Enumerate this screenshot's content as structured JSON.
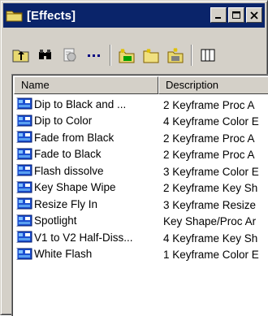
{
  "window": {
    "title": "[Effects]"
  },
  "toolbar": {
    "tools": [
      {
        "icon": "up-folder-icon"
      },
      {
        "icon": "find-icon"
      },
      {
        "icon": "properties-icon"
      },
      {
        "icon": "small-icons-view-icon"
      },
      {
        "icon": "new-folder-icon"
      },
      {
        "icon": "open-folder-icon"
      },
      {
        "icon": "folder-properties-icon"
      },
      {
        "icon": "columns-icon"
      }
    ]
  },
  "list": {
    "columns": [
      "Name",
      "Description"
    ],
    "rows": [
      {
        "name": "Dip to Black and ...",
        "description": "2 Keyframe Proc A"
      },
      {
        "name": "Dip to Color",
        "description": "4 Keyframe Color E"
      },
      {
        "name": "Fade from Black",
        "description": "2 Keyframe Proc A"
      },
      {
        "name": "Fade to Black",
        "description": "2 Keyframe Proc A"
      },
      {
        "name": "Flash dissolve",
        "description": "3 Keyframe Color E"
      },
      {
        "name": "Key Shape Wipe",
        "description": "2 Keyframe Key Sh"
      },
      {
        "name": "Resize Fly In",
        "description": "3 Keyframe Resize"
      },
      {
        "name": "Spotlight",
        "description": "Key Shape/Proc Ar"
      },
      {
        "name": "V1 to V2 Half-Diss...",
        "description": "4 Keyframe Key Sh"
      },
      {
        "name": "White Flash",
        "description": "1 Keyframe Color E"
      }
    ]
  },
  "colors": {
    "titlebar": "#0a246a",
    "face": "#d4d0c8"
  }
}
